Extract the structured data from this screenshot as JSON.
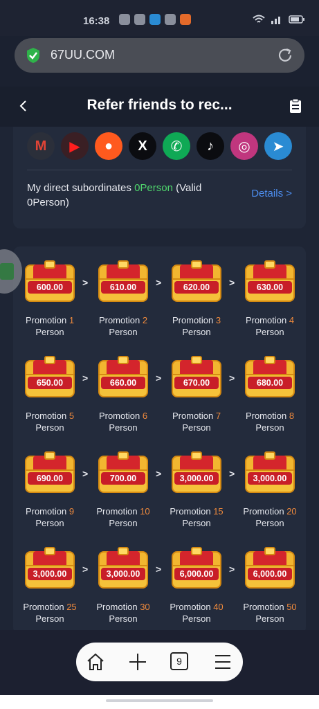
{
  "status": {
    "time": "16:38"
  },
  "browser": {
    "url": "67UU.COM"
  },
  "page": {
    "title": "Refer friends to rec..."
  },
  "social": {
    "items": [
      {
        "name": "gmail",
        "glyph": "M",
        "bg": "#2b2f3a",
        "fg": "#e14436"
      },
      {
        "name": "youtube",
        "glyph": "▶",
        "bg": "#3a1f24",
        "fg": "#ff1e1e"
      },
      {
        "name": "kuaishou",
        "glyph": "●",
        "bg": "#ff5a1e",
        "fg": "#ffffff"
      },
      {
        "name": "x",
        "glyph": "X",
        "bg": "#0b0c10",
        "fg": "#ffffff"
      },
      {
        "name": "whatsapp",
        "glyph": "✆",
        "bg": "#0fa955",
        "fg": "#ffffff"
      },
      {
        "name": "tiktok",
        "glyph": "♪",
        "bg": "#0b0c10",
        "fg": "#ffffff"
      },
      {
        "name": "instagram",
        "glyph": "◎",
        "bg": "#c0367e",
        "fg": "#ffffff"
      },
      {
        "name": "telegram",
        "glyph": "➤",
        "bg": "#2a8bd3",
        "fg": "#ffffff"
      }
    ]
  },
  "subordinates": {
    "label_pre": "My direct subordinates",
    "count": "0Person",
    "label_post": " (Valid 0Person)",
    "details": "Details >"
  },
  "rewards": [
    {
      "amount": "600.00",
      "prefix": "Promotion",
      "num": "1",
      "unit": "Person"
    },
    {
      "amount": "610.00",
      "prefix": "Promotion",
      "num": "2",
      "unit": "Person"
    },
    {
      "amount": "620.00",
      "prefix": "Promotion",
      "num": "3",
      "unit": "Person"
    },
    {
      "amount": "630.00",
      "prefix": "Promotion",
      "num": "4",
      "unit": "Person"
    },
    {
      "amount": "650.00",
      "prefix": "Promotion",
      "num": "5",
      "unit": "Person"
    },
    {
      "amount": "660.00",
      "prefix": "Promotion",
      "num": "6",
      "unit": "Person"
    },
    {
      "amount": "670.00",
      "prefix": "Promotion",
      "num": "7",
      "unit": "Person"
    },
    {
      "amount": "680.00",
      "prefix": "Promotion",
      "num": "8",
      "unit": "Person"
    },
    {
      "amount": "690.00",
      "prefix": "Promotion",
      "num": "9",
      "unit": "Person"
    },
    {
      "amount": "700.00",
      "prefix": "Promotion",
      "num": "10",
      "unit": "Person"
    },
    {
      "amount": "3,000.00",
      "prefix": "Promotion",
      "num": "15",
      "unit": "Person"
    },
    {
      "amount": "3,000.00",
      "prefix": "Promotion",
      "num": "20",
      "unit": "Person"
    },
    {
      "amount": "3,000.00",
      "prefix": "Promotion",
      "num": "25",
      "unit": "Person"
    },
    {
      "amount": "3,000.00",
      "prefix": "Promotion",
      "num": "30",
      "unit": "Person"
    },
    {
      "amount": "6,000.00",
      "prefix": "Promotion",
      "num": "40",
      "unit": "Person"
    },
    {
      "amount": "6,000.00",
      "prefix": "Promotion",
      "num": "50",
      "unit": "Person"
    }
  ],
  "reward_separator": ">",
  "nav": {
    "tab_count": "9"
  },
  "colors": {
    "accent_green": "#4fd46c",
    "accent_orange": "#f08a3c",
    "link_blue": "#4d8ef0"
  }
}
